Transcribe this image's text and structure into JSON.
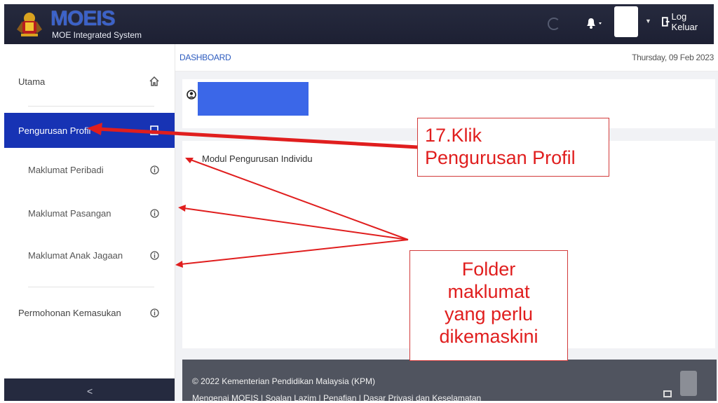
{
  "header": {
    "logo_text": "MOEIS",
    "subtitle": "MOE Integrated System",
    "logout_label": "Log Keluar"
  },
  "sidebar": {
    "items": [
      {
        "label": "Utama",
        "icon": "home-icon"
      },
      {
        "label": "Pengurusan Profil",
        "icon": "card-icon",
        "active": true
      },
      {
        "label": "Maklumat Peribadi",
        "icon": "info-icon"
      },
      {
        "label": "Maklumat Pasangan",
        "icon": "info-icon"
      },
      {
        "label": "Maklumat Anak Jagaan",
        "icon": "info-icon"
      },
      {
        "label": "Permohonan Kemasukan",
        "icon": "info-icon"
      }
    ],
    "collapse_label": "<"
  },
  "main": {
    "breadcrumb": "DASHBOARD",
    "date": "Thursday, 09 Feb 2023",
    "module_title": "Modul Pengurusan Individu"
  },
  "footer": {
    "copyright": "© 2022 Kementerian Pendidikan Malaysia (KPM)",
    "links": "Mengenai MOEIS | Soalan Lazim | Penafian | Dasar Privasi dan Keselamatan"
  },
  "annotations": {
    "step_line1": "17.Klik",
    "step_line2": "Pengurusan Profil",
    "folder_lines": [
      "Folder",
      "maklumat",
      "yang perlu",
      "dikemaskini"
    ]
  },
  "colors": {
    "topbar": "#1f2236",
    "active_menu": "#1733b4",
    "annotation_red": "#e01e1e",
    "footer": "#50545f"
  }
}
